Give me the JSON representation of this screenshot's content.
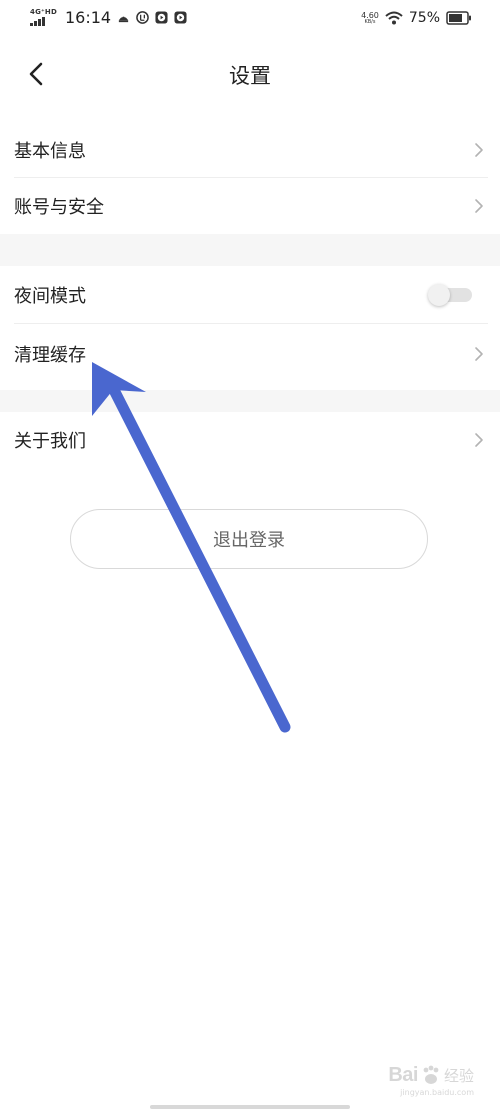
{
  "status_bar": {
    "network_type": "4G⁺HD",
    "time": "16:14",
    "speed_value": "4.60",
    "speed_unit": "KB/s",
    "battery_percent": "75%"
  },
  "header": {
    "title": "设置"
  },
  "groups": [
    {
      "items": [
        {
          "label": "基本信息",
          "control": "chevron"
        },
        {
          "label": "账号与安全",
          "control": "chevron"
        }
      ]
    },
    {
      "items": [
        {
          "label": "夜间模式",
          "control": "toggle",
          "toggle_on": false
        },
        {
          "label": "清理缓存",
          "control": "chevron"
        }
      ]
    },
    {
      "items": [
        {
          "label": "关于我们",
          "control": "chevron"
        }
      ]
    }
  ],
  "logout": {
    "label": "退出登录"
  },
  "annotation": {
    "color": "#4a67cf"
  },
  "watermark": {
    "brand": "Bai",
    "brand_suffix": "经验",
    "sub": "jingyan.baidu.com"
  }
}
